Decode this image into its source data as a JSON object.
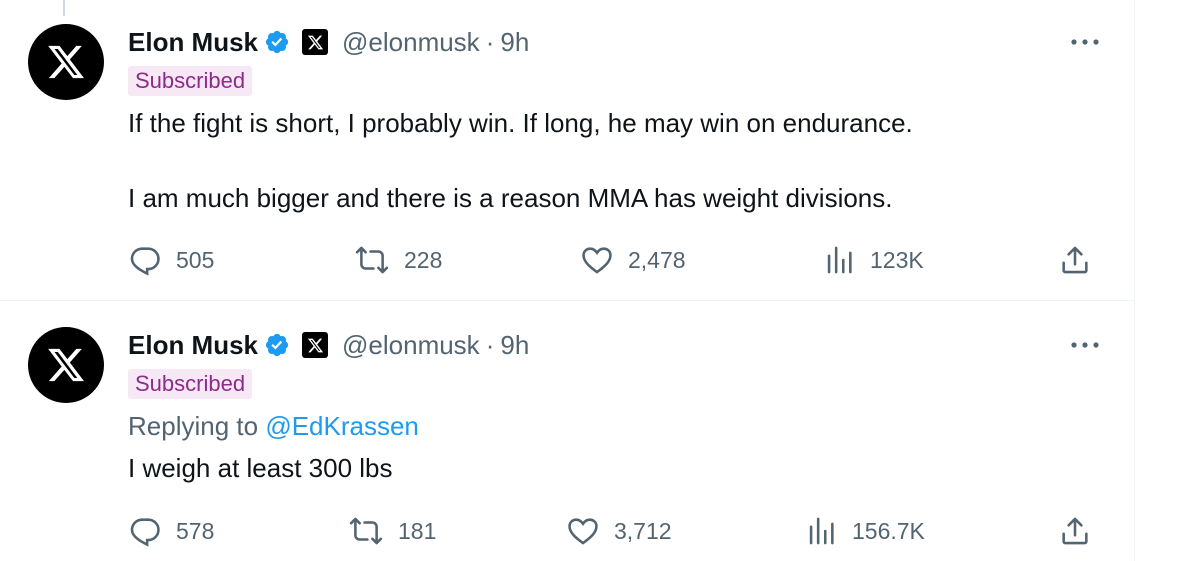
{
  "tweets": [
    {
      "author": "Elon Musk",
      "handle": "@elonmusk",
      "separator": "·",
      "time": "9h",
      "badge": "Subscribed",
      "lines": [
        "If the fight is short, I probably win. If long, he may win on endurance.",
        "I am much bigger and there is a reason MMA has weight divisions."
      ],
      "replies": "505",
      "reposts": "228",
      "likes": "2,478",
      "views": "123K"
    },
    {
      "author": "Elon Musk",
      "handle": "@elonmusk",
      "separator": "·",
      "time": "9h",
      "badge": "Subscribed",
      "replying_prefix": "Replying to ",
      "replying_to": "@EdKrassen",
      "lines": [
        "I weigh at least 300 lbs"
      ],
      "replies": "578",
      "reposts": "181",
      "likes": "3,712",
      "views": "156.7K"
    }
  ],
  "icons": {
    "avatar": "x-logo-icon",
    "verified": "verified-badge-icon",
    "affiliate": "x-affiliate-icon",
    "more": "more-dots-icon",
    "reply": "reply-icon",
    "repost": "repost-icon",
    "like": "heart-icon",
    "views": "views-icon",
    "share": "share-icon"
  },
  "colors": {
    "verified": "#1d9bf0",
    "link": "#1d9bf0",
    "muted": "#536471",
    "subscribed_bg": "#f7e8f6",
    "subscribed_text": "#8e2a8c"
  }
}
